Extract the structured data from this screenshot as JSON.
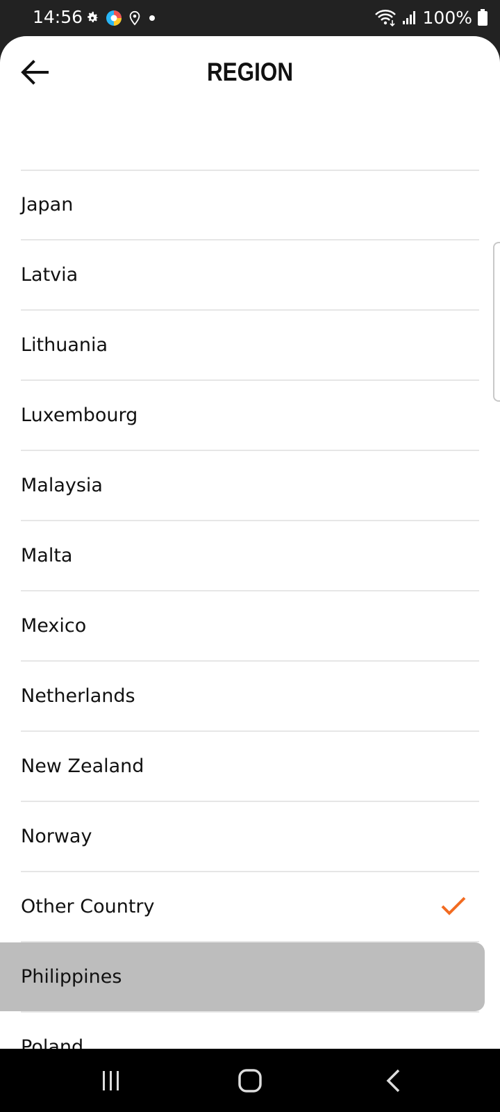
{
  "status_bar": {
    "time": "14:56",
    "battery": "100%",
    "left_icons": [
      "gear-icon",
      "app-icon",
      "location-icon",
      "dot-icon"
    ],
    "right_icons": [
      "wifi-icon",
      "signal-icon",
      "battery-icon"
    ]
  },
  "header": {
    "title": "REGION",
    "back_icon": "arrow-left-icon"
  },
  "list": {
    "partial_item": "·",
    "items": [
      {
        "label": "Japan",
        "selected": false,
        "pressed": false
      },
      {
        "label": "Latvia",
        "selected": false,
        "pressed": false
      },
      {
        "label": "Lithuania",
        "selected": false,
        "pressed": false
      },
      {
        "label": "Luxembourg",
        "selected": false,
        "pressed": false
      },
      {
        "label": "Malaysia",
        "selected": false,
        "pressed": false
      },
      {
        "label": "Malta",
        "selected": false,
        "pressed": false
      },
      {
        "label": "Mexico",
        "selected": false,
        "pressed": false
      },
      {
        "label": "Netherlands",
        "selected": false,
        "pressed": false
      },
      {
        "label": "New Zealand",
        "selected": false,
        "pressed": false
      },
      {
        "label": "Norway",
        "selected": false,
        "pressed": false
      },
      {
        "label": "Other Country",
        "selected": true,
        "pressed": false
      },
      {
        "label": "Philippines",
        "selected": false,
        "pressed": true
      },
      {
        "label": "Poland",
        "selected": false,
        "pressed": false
      }
    ]
  },
  "colors": {
    "accent": "#f26b21",
    "pressed": "#bdbdbd",
    "divider": "#e6e6e6",
    "status_bg": "#222222",
    "nav_bg": "#000000"
  },
  "nav_bar": {
    "buttons": [
      "recents-icon",
      "home-icon",
      "back-icon"
    ]
  }
}
